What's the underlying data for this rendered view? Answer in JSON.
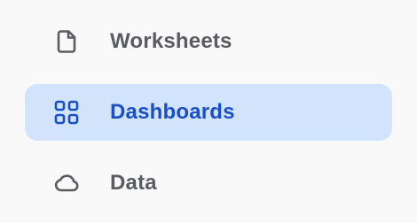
{
  "sidebar": {
    "items": [
      {
        "label": "Worksheets",
        "icon": "document-icon",
        "active": false
      },
      {
        "label": "Dashboards",
        "icon": "dashboard-grid-icon",
        "active": true
      },
      {
        "label": "Data",
        "icon": "cloud-icon",
        "active": false
      }
    ],
    "colors": {
      "text": "#5a5c62",
      "active_text": "#1b4fc4",
      "active_background": "#d2e3fc",
      "background": "#f9f9fa"
    }
  }
}
